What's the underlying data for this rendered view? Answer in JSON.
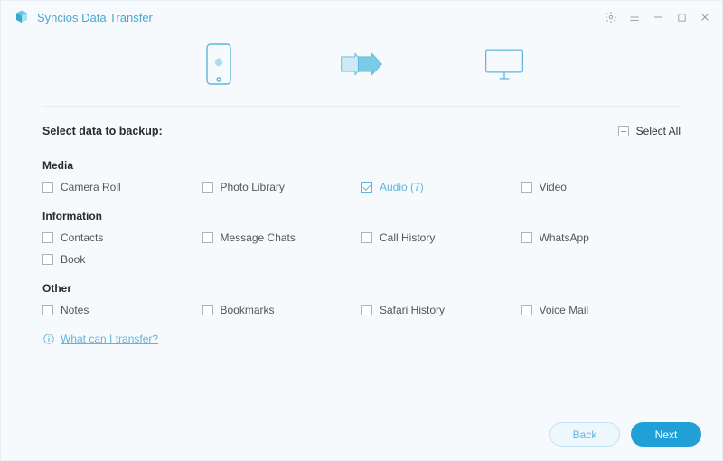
{
  "app": {
    "title": "Syncios Data Transfer"
  },
  "header": {
    "prompt": "Select data to backup:",
    "select_all": "Select All"
  },
  "groups": {
    "media": {
      "title": "Media",
      "items": [
        {
          "label": "Camera Roll",
          "checked": false
        },
        {
          "label": "Photo Library",
          "checked": false
        },
        {
          "label": "Audio (7)",
          "checked": true
        },
        {
          "label": "Video",
          "checked": false
        }
      ]
    },
    "information": {
      "title": "Information",
      "items": [
        {
          "label": "Contacts",
          "checked": false
        },
        {
          "label": "Message Chats",
          "checked": false
        },
        {
          "label": "Call History",
          "checked": false
        },
        {
          "label": "WhatsApp",
          "checked": false
        },
        {
          "label": "Book",
          "checked": false
        }
      ]
    },
    "other": {
      "title": "Other",
      "items": [
        {
          "label": "Notes",
          "checked": false
        },
        {
          "label": "Bookmarks",
          "checked": false
        },
        {
          "label": "Safari History",
          "checked": false
        },
        {
          "label": "Voice Mail",
          "checked": false
        }
      ]
    }
  },
  "help": {
    "link": "What can I transfer?"
  },
  "footer": {
    "back": "Back",
    "next": "Next"
  }
}
